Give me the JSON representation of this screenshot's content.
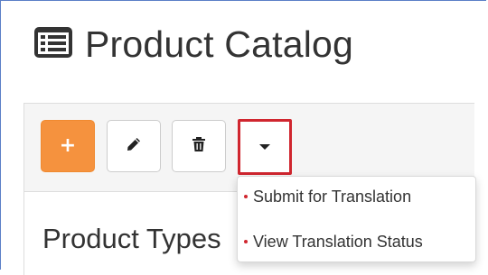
{
  "page": {
    "title": "Product Catalog",
    "title_icon": "list-alt-icon"
  },
  "toolbar": {
    "add_icon": "plus-icon",
    "add_label": "+",
    "edit_icon": "pencil-icon",
    "delete_icon": "trash-icon",
    "more_icon": "caret-down-icon",
    "add_color": "#f5923e",
    "highlight_color": "#d0262f"
  },
  "section": {
    "heading": "Product Types"
  },
  "dropdown": {
    "items": [
      {
        "label": "Submit for Translation"
      },
      {
        "label": "View Translation Status"
      }
    ]
  }
}
